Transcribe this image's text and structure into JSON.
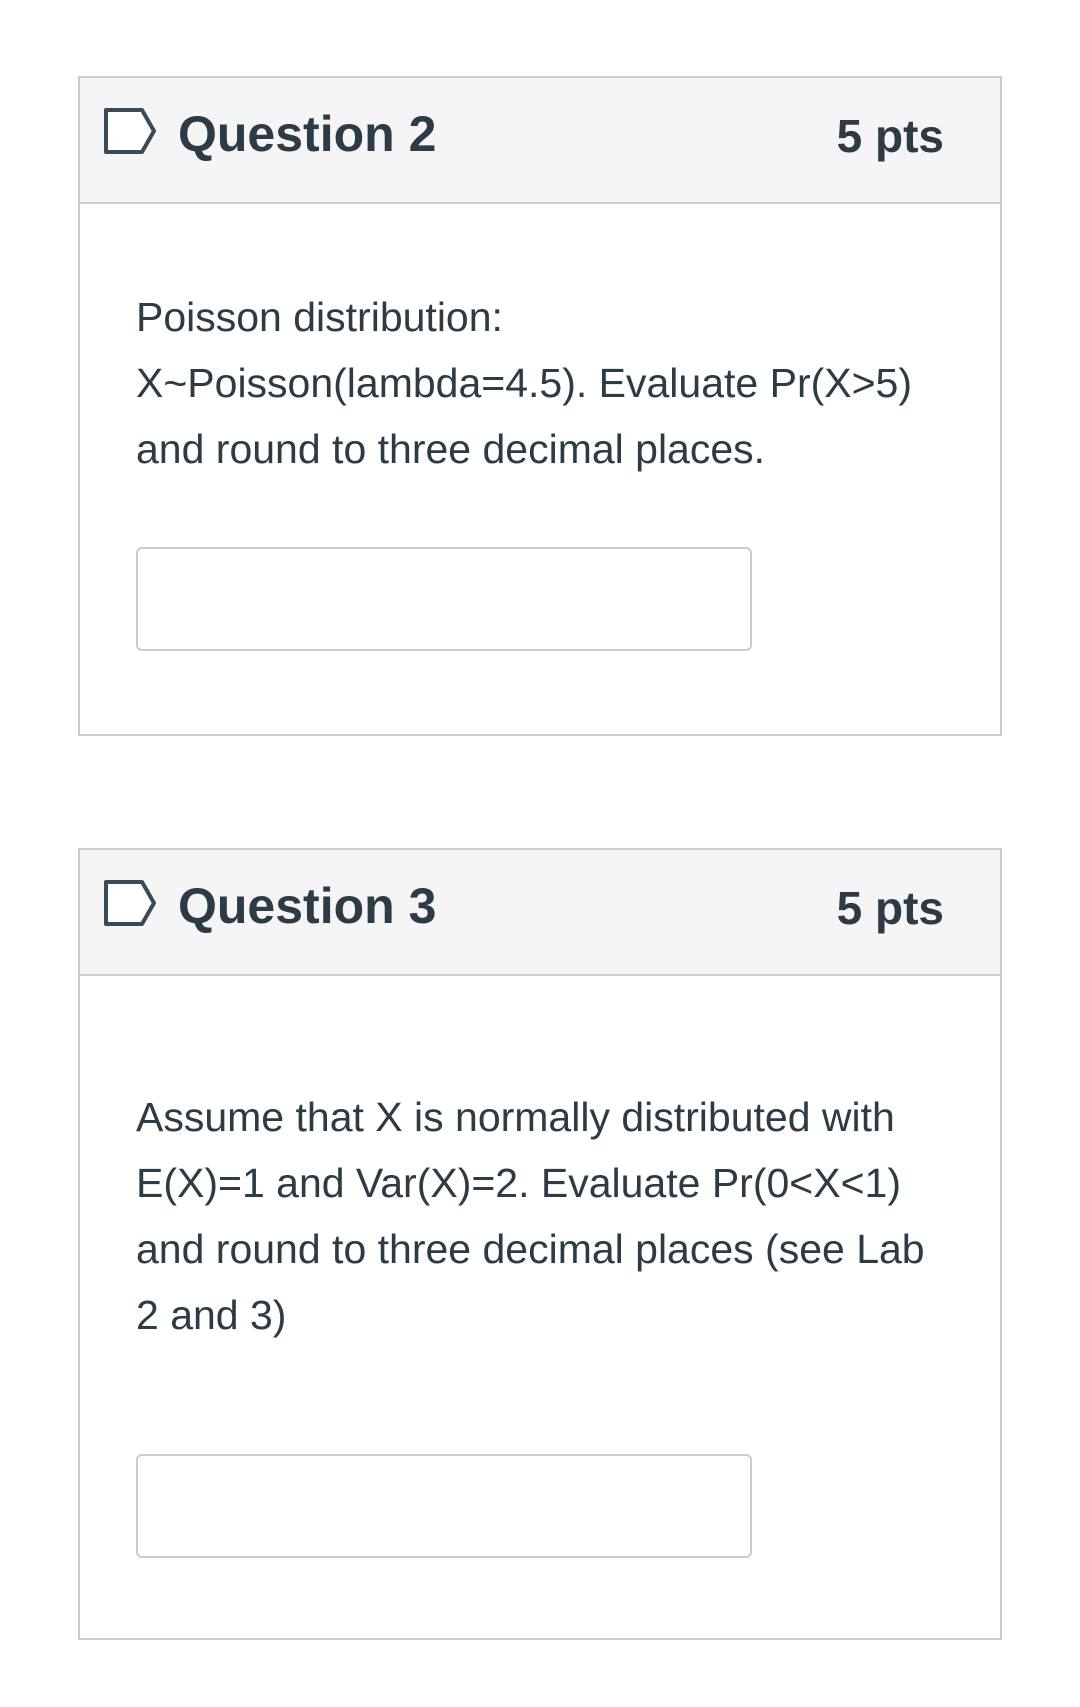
{
  "questions": [
    {
      "title": "Question 2",
      "points": "5 pts",
      "body_lines": [
        "Poisson distribution:",
        "X~Poisson(lambda=4.5). Evaluate Pr(X>5) and round to three decimal places."
      ],
      "answer_value": ""
    },
    {
      "title": "Question 3",
      "points": "5 pts",
      "body_lines": [
        "Assume that X is normally distributed with E(X)=1 and Var(X)=2. Evaluate Pr(0<X<1) and round to three decimal places (see Lab 2 and 3)"
      ],
      "answer_value": ""
    }
  ],
  "icons": {
    "flag": "flag-outline-icon"
  },
  "colors": {
    "text": "#2d3b45",
    "header_bg": "#f5f5f5",
    "border": "#c7cdd1",
    "icon_stroke": "#394b58"
  }
}
